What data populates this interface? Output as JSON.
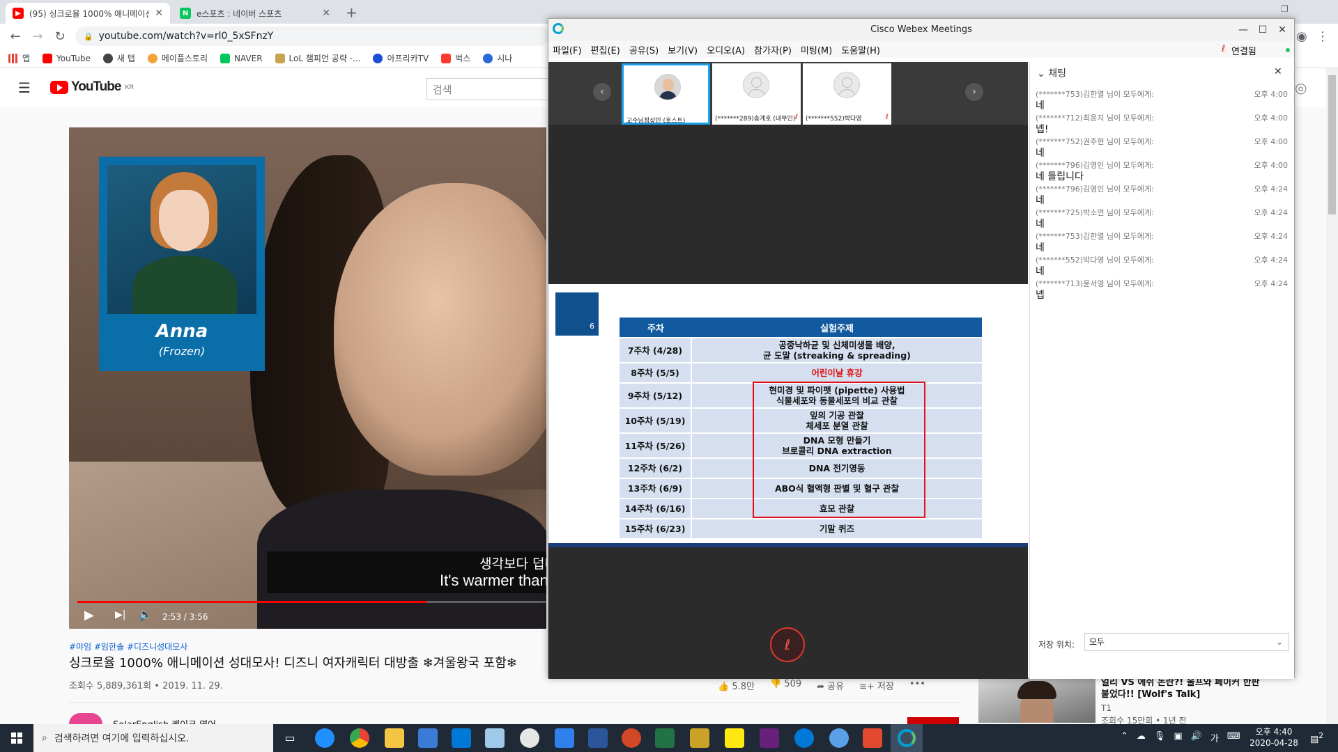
{
  "browser": {
    "tabs": [
      {
        "title": "(95) 싱크로율 1000% 애니메이션",
        "active": true
      },
      {
        "title": "e스포츠 : 네이버 스포츠",
        "active": false
      }
    ],
    "new_tab": "+",
    "url": "youtube.com/watch?v=rl0_5xSFnzY",
    "bookmarks": [
      "앱",
      "YouTube",
      "새 탭",
      "메이플스토리",
      "NAVER",
      "LoL 챔피언 공략 -...",
      "아프리카TV",
      "벅스",
      "시나"
    ]
  },
  "youtube": {
    "logo_text": "YouTube",
    "logo_region": "KR",
    "search_placeholder": "검색",
    "video": {
      "anna_name": "Anna",
      "anna_sub": "(Frozen)",
      "caption_line1": "생각보다 덥네",
      "caption_line2": "It's warmer than I",
      "time": "2:53 / 3:56",
      "progress": 0.745
    },
    "hashtags": "#야임 #임한솔 #디즈니성대모사",
    "title": "싱크로율 1000% 애니메이션 성대모사! 디즈니 여자캐릭터 대방출 ❄겨울왕국 포함❄",
    "meta": "조회수 5,889,361회 • 2019. 11. 29.",
    "actions": {
      "like": "5.8만",
      "dislike": "509",
      "share": "공유",
      "save": "저장",
      "more": "•••"
    },
    "channel": "SolarEnglish 케이크 영어",
    "recommended": {
      "title": "얼리 VS 에쉬 논란?! 울프와 페이커 한판 붙었다!! [Wolf's Talk]",
      "channel": "T1",
      "views": "조회수 15만회 • 1년 전"
    }
  },
  "webex": {
    "title": "Cisco Webex Meetings",
    "menu": [
      "파일(F)",
      "편집(E)",
      "공유(S)",
      "보기(V)",
      "오디오(A)",
      "참가자(P)",
      "미팅(M)",
      "도움말(H)"
    ],
    "connection": "연결됨",
    "participants": [
      {
        "name": "교수님정상민 (호스트)",
        "selected": true,
        "muted": false
      },
      {
        "name": "(*******289)송계호 (내부인)",
        "selected": false,
        "muted": true
      },
      {
        "name": "(*******552)박다영",
        "selected": false,
        "muted": true
      }
    ],
    "slide": {
      "number": "6",
      "headers": [
        "주차",
        "실험주제"
      ],
      "rows": [
        {
          "week": "7주차 (4/28)",
          "topic": "공중낙하균 및 신체미생물 배양,\n균 도말 (streaking & spreading)",
          "red": false
        },
        {
          "week": "8주차 (5/5)",
          "topic": "어린이날 휴강",
          "red": true
        },
        {
          "week": "9주차 (5/12)",
          "topic": "현미경 및 파이펫 (pipette) 사용법\n식물세포와 동물세포의 비교 관찰",
          "red": false
        },
        {
          "week": "10주차 (5/19)",
          "topic": "잎의 기공 관찰\n체세포 분열 관찰",
          "red": false
        },
        {
          "week": "11주차 (5/26)",
          "topic": "DNA 모형 만들기\n브로콜리 DNA extraction",
          "red": false
        },
        {
          "week": "12주차 (6/2)",
          "topic": "DNA 전기영동",
          "red": false
        },
        {
          "week": "13주차 (6/9)",
          "topic": "ABO식 혈액형 판별 및 혈구 관찰",
          "red": false
        },
        {
          "week": "14주차 (6/16)",
          "topic": "효모 관찰",
          "red": false
        },
        {
          "week": "15주차 (6/23)",
          "topic": "기말 퀴즈",
          "red": false
        }
      ]
    },
    "chat": {
      "header": "채팅",
      "messages": [
        {
          "from": "(*******753)김한열 님이 모두에게:",
          "time": "오후 4:00",
          "text": "네"
        },
        {
          "from": "(*******712)최윤지 님이 모두에게:",
          "time": "오후 4:00",
          "text": "넵!"
        },
        {
          "from": "(*******752)권주현 님이 모두에게:",
          "time": "오후 4:00",
          "text": "네"
        },
        {
          "from": "(*******796)김영인 님이 모두에게:",
          "time": "오후 4:00",
          "text": "네 들립니다"
        },
        {
          "from": "(*******796)김영인 님이 모두에게:",
          "time": "오후 4:24",
          "text": "네"
        },
        {
          "from": "(*******725)박소연 님이 모두에게:",
          "time": "오후 4:24",
          "text": "네"
        },
        {
          "from": "(*******753)김한열 님이 모두에게:",
          "time": "오후 4:24",
          "text": "네"
        },
        {
          "from": "(*******552)박다영 님이 모두에게:",
          "time": "오후 4:24",
          "text": "네"
        },
        {
          "from": "(*******713)윤서영 님이 모두에게:",
          "time": "오후 4:24",
          "text": "넵"
        }
      ],
      "save_label": "저장 위치:",
      "save_value": "모두"
    }
  },
  "taskbar": {
    "search_placeholder": "검색하려면 여기에 입력하십시오.",
    "ime": "가",
    "clock_time": "오후 4:40",
    "clock_date": "2020-04-28",
    "notifications": "2"
  }
}
